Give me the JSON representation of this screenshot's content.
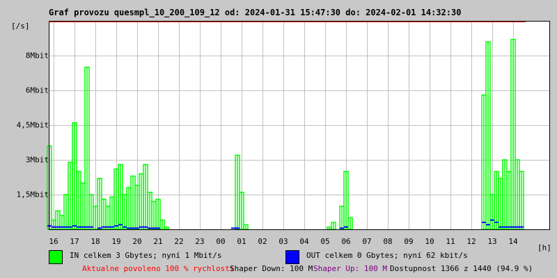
{
  "title": "Graf provozu quesmpl_10_200_109_12 od: 2024-01-31 15:47:30 do: 2024-02-01 14:32:30",
  "legend": {
    "in_text": "IN celkem 3 Gbytes; nyní 1 Mbit/s",
    "out_text": "OUT celkem 0 Gbytes; nyní 62 kbit/s",
    "in_color": "#00ff00",
    "out_color": "#0000ff"
  },
  "status": {
    "allowed": "Aktualne povoleno 100 % rychlosti",
    "shaper_down": "Shaper Down: 100 M",
    "shaper_up": "Shaper Up: 100 M",
    "availability": "Dostupnost 1366 z 1440 (94.9 %)",
    "allowed_color": "#ff0000",
    "shaper_up_color": "#800080"
  },
  "chart_data": {
    "type": "area",
    "title": "Graf provozu quesmpl_10_200_109_12 od: 2024-01-31 15:47:30 do: 2024-02-01 14:32:30",
    "ylabel": "[/s]",
    "xlabel": "[h]",
    "y_unit": "Mbit/s",
    "ylim": [
      0,
      9
    ],
    "y_ticks": [
      {
        "value": 1.5,
        "label": "1,5Mbit"
      },
      {
        "value": 3,
        "label": "3Mbit"
      },
      {
        "value": 4.5,
        "label": "4,5Mbit"
      },
      {
        "value": 6,
        "label": "6Mbit"
      },
      {
        "value": 7.5,
        "label": "8Mbit"
      }
    ],
    "x_ticks": [
      "16",
      "17",
      "18",
      "19",
      "20",
      "21",
      "22",
      "23",
      "00",
      "01",
      "02",
      "03",
      "04",
      "05",
      "06",
      "07",
      "08",
      "09",
      "10",
      "11",
      "12",
      "13",
      "14"
    ],
    "x_start_hours_from_16": -0.2,
    "x_step_hours": 0.2,
    "grid": true,
    "series": [
      {
        "name": "IN",
        "color": "#00ff00",
        "values": [
          3.6,
          0.4,
          0.8,
          0.6,
          1.5,
          2.9,
          4.6,
          2.5,
          2.0,
          7.0,
          1.5,
          1.0,
          2.2,
          1.3,
          1.0,
          1.4,
          2.6,
          2.8,
          1.5,
          1.8,
          2.3,
          1.9,
          2.4,
          2.8,
          1.6,
          1.2,
          1.3,
          0.4,
          0.1,
          0,
          0,
          0,
          0,
          0,
          0,
          0,
          0,
          0,
          0,
          0,
          0,
          0,
          0,
          0,
          0,
          3.2,
          1.6,
          0.2,
          0,
          0,
          0,
          0,
          0,
          0,
          0,
          0,
          0,
          0,
          0,
          0,
          0,
          0,
          0,
          0,
          0,
          0,
          0,
          0.1,
          0.3,
          0,
          1.0,
          2.5,
          0.5,
          0,
          0,
          0,
          0,
          0,
          0,
          0,
          0,
          0,
          0,
          0,
          0,
          0,
          0,
          0,
          0,
          0,
          0,
          0,
          0,
          0,
          0,
          0,
          0,
          0,
          0,
          0,
          0,
          0,
          0,
          0,
          5.8,
          8.1,
          1.5,
          2.5,
          2.2,
          3.0,
          2.5,
          8.2,
          3.0,
          2.5
        ]
      },
      {
        "name": "OUT",
        "color": "#0000ff",
        "values": [
          0.15,
          0.1,
          0.1,
          0.1,
          0.1,
          0.1,
          0.15,
          0.1,
          0.1,
          0.1,
          0.1,
          0,
          0.05,
          0.1,
          0.1,
          0.1,
          0.15,
          0.2,
          0.1,
          0.05,
          0.05,
          0.05,
          0.1,
          0.1,
          0.05,
          0.05,
          0.05,
          0,
          0,
          0,
          0,
          0,
          0,
          0,
          0,
          0,
          0,
          0,
          0,
          0,
          0,
          0,
          0,
          0,
          0.05,
          0.05,
          0,
          0,
          0,
          0,
          0,
          0,
          0,
          0,
          0,
          0,
          0,
          0,
          0,
          0,
          0,
          0,
          0,
          0,
          0,
          0,
          0,
          0,
          0,
          0,
          0.05,
          0.1,
          0,
          0,
          0,
          0,
          0,
          0,
          0,
          0,
          0,
          0,
          0,
          0,
          0,
          0,
          0,
          0,
          0,
          0,
          0,
          0,
          0,
          0,
          0,
          0,
          0,
          0,
          0,
          0,
          0,
          0,
          0,
          0,
          0.3,
          0.2,
          0.4,
          0.3,
          0.1,
          0.1,
          0.1,
          0.1,
          0.1,
          0.1
        ]
      }
    ]
  }
}
